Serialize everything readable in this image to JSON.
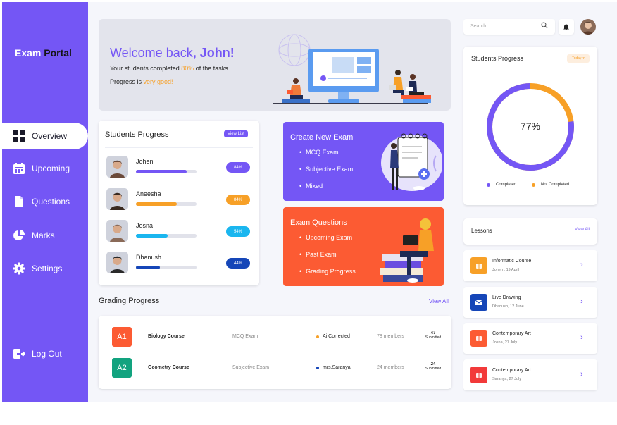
{
  "brand": {
    "part1": "Exam",
    "part2": "Portal"
  },
  "nav": [
    {
      "label": "Overview",
      "icon": "grid-icon",
      "active": true
    },
    {
      "label": "Upcoming",
      "icon": "calendar-icon"
    },
    {
      "label": "Questions",
      "icon": "file-icon"
    },
    {
      "label": "Marks",
      "icon": "pie-chart-icon"
    },
    {
      "label": "Settings",
      "icon": "gear-icon"
    }
  ],
  "logout": {
    "label": "Log Out",
    "icon": "logout-icon"
  },
  "banner": {
    "welcome": "Welcome back",
    "name": ", John!",
    "line1_pre": "Your students completed ",
    "line1_pct": "80%",
    "line1_post": " of the tasks.",
    "line2_pre": "Progress is ",
    "line2_hl": "very good!"
  },
  "students_progress": {
    "title": "Students Progress",
    "view_label": "View List",
    "students": [
      {
        "name": "Johen",
        "pct": "84%",
        "progress": 0.84,
        "color": "#7456f5"
      },
      {
        "name": "Aneesha",
        "pct": "84%",
        "progress": 0.68,
        "color": "#f7a027"
      },
      {
        "name": "Josna",
        "pct": "54%",
        "progress": 0.52,
        "color": "#1ab6ef"
      },
      {
        "name": "Dhanush",
        "pct": "44%",
        "progress": 0.4,
        "color": "#1546b8"
      }
    ]
  },
  "create_exam": {
    "title": "Create New Exam",
    "items": [
      "MCQ Exam",
      "Subjective Exam",
      "Mixed"
    ],
    "color": "#7456f5"
  },
  "exam_questions": {
    "title": "Exam Questions",
    "items": [
      "Upcoming Exam",
      "Past Exam",
      "Grading Progress"
    ],
    "color": "#fc5b33"
  },
  "grading": {
    "title": "Grading Progress",
    "view_all": "View All",
    "rows": [
      {
        "badge": "A1",
        "badge_color": "#fc5b33",
        "course": "Biology Course",
        "type": "MCQ Exam",
        "dot_color": "#f7a027",
        "by": "Ai Corrected",
        "members": "78 members",
        "count": "47",
        "count_label": "Submitted"
      },
      {
        "badge": "A2",
        "badge_color": "#12a37f",
        "course": "Geometry Course",
        "type": "Subjective Exam",
        "dot_color": "#1546b8",
        "by": "mrs.Saranya",
        "members": "24 members",
        "count": "24",
        "count_label": "Submitted"
      }
    ]
  },
  "search": {
    "placeholder": "Search"
  },
  "donut": {
    "title": "Students Progress",
    "filter": "Today",
    "value": "77%",
    "fraction": 0.77,
    "legend": [
      {
        "label": "Completed",
        "color": "#7456f5"
      },
      {
        "label": "Not Completed",
        "color": "#f7a027"
      }
    ]
  },
  "lessons": {
    "title": "Lessons",
    "view_all": "View All",
    "items": [
      {
        "title": "Informatic Course",
        "sub": "Johen , 19 April",
        "color": "#f7a027",
        "icon": "book-icon"
      },
      {
        "title": "Live Drawing",
        "sub": "Dhanush, 12 June",
        "color": "#1546b8",
        "icon": "mail-icon"
      },
      {
        "title": "Contemporary Art",
        "sub": "Josna, 27 July",
        "color": "#fc5b33",
        "icon": "book-icon"
      },
      {
        "title": "Contemporary Art",
        "sub": "Saranya, 27 July",
        "color": "#f23a3a",
        "icon": "book-icon"
      }
    ]
  }
}
